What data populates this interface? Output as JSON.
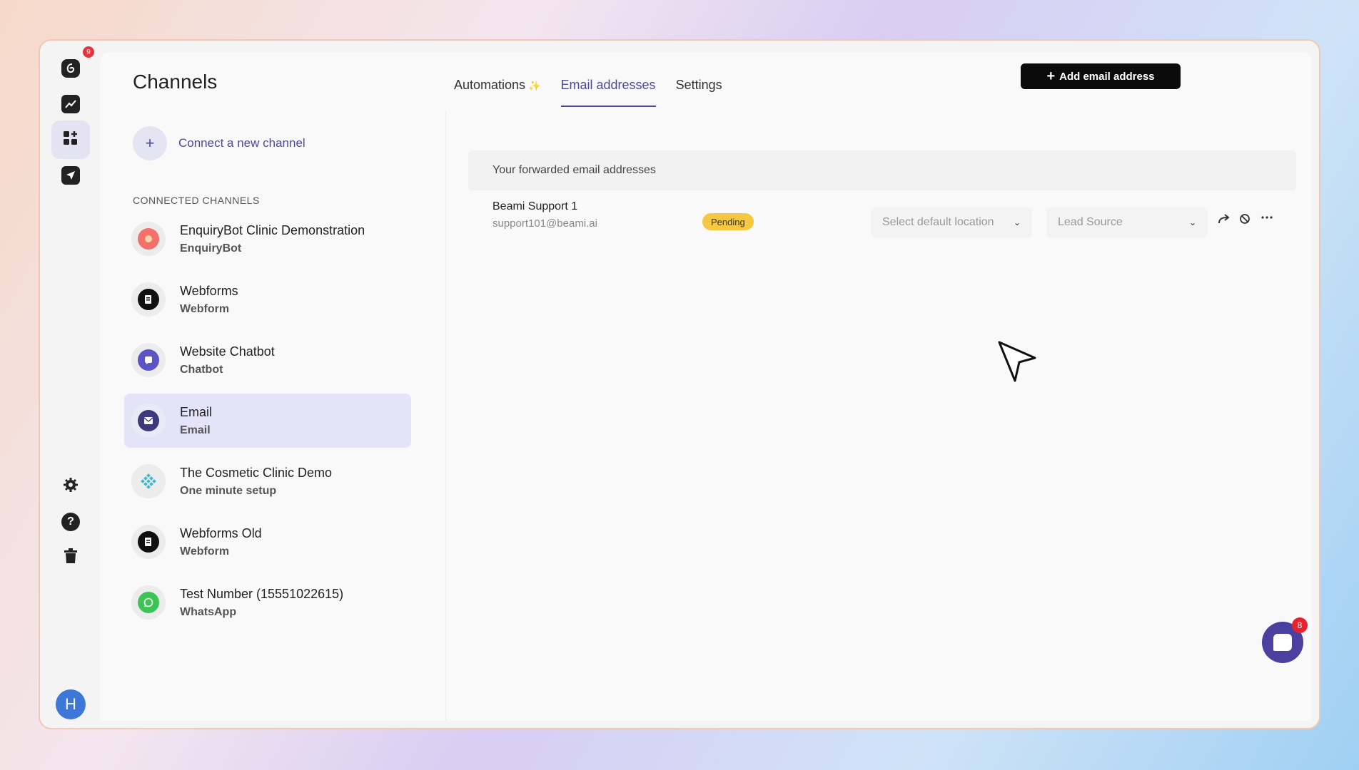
{
  "rail": {
    "logo_badge": "9",
    "avatar_initial": "H"
  },
  "header": {
    "title": "Channels",
    "tabs": [
      {
        "label": "Automations",
        "sparkle": "✨"
      },
      {
        "label": "Email addresses"
      },
      {
        "label": "Settings"
      }
    ],
    "add_button_label": "Add email address",
    "add_button_icon": "+"
  },
  "sidebar": {
    "connect_label": "Connect a new channel",
    "connect_icon": "+",
    "section_label": "CONNECTED CHANNELS",
    "channels": [
      {
        "name": "EnquiryBot Clinic Demonstration",
        "type": "EnquiryBot",
        "icon": "enquirybot-icon",
        "color": "#f4706a"
      },
      {
        "name": "Webforms",
        "type": "Webform",
        "icon": "webform-icon",
        "color": "#111111"
      },
      {
        "name": "Website Chatbot",
        "type": "Chatbot",
        "icon": "chatbot-icon",
        "color": "#5b54c4"
      },
      {
        "name": "Email",
        "type": "Email",
        "icon": "email-icon",
        "color": "#3b3a7c"
      },
      {
        "name": "The Cosmetic Clinic Demo",
        "type": "One minute setup",
        "icon": "snowflake-icon",
        "color": "#45b6c9"
      },
      {
        "name": "Webforms Old",
        "type": "Webform",
        "icon": "webform-icon",
        "color": "#111111"
      },
      {
        "name": "Test Number (15551022615)",
        "type": "WhatsApp",
        "icon": "whatsapp-icon",
        "color": "#3cc455"
      }
    ]
  },
  "email_table": {
    "header": "Your forwarded email addresses",
    "rows": [
      {
        "name": "Beami Support 1",
        "email": "support101@beami.ai",
        "status": "Pending",
        "location_placeholder": "Select default location",
        "lead_source_placeholder": "Lead Source"
      }
    ]
  },
  "chat_widget": {
    "badge": "8"
  },
  "colors": {
    "accent": "#4b4a9a",
    "pending": "#f5c842",
    "active_row": "#e4e3f8"
  }
}
